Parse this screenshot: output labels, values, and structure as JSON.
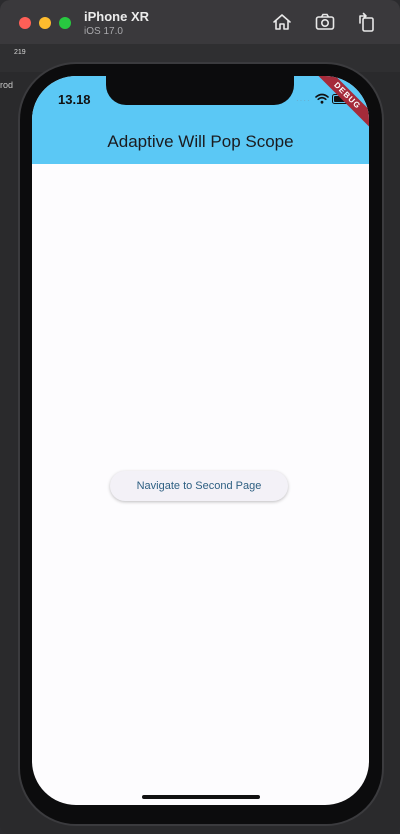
{
  "simulator": {
    "device_name": "iPhone XR",
    "os_version": "iOS 17.0",
    "toolbar_icons": [
      "home-icon",
      "screenshot-icon",
      "rotate-icon"
    ]
  },
  "desktop": {
    "badge_count": "219",
    "label": "rod"
  },
  "app": {
    "status_time": "13.18",
    "title": "Adaptive Will Pop Scope",
    "debug_banner": "DEBUG",
    "navigate_button_label": "Navigate to Second Page",
    "colors": {
      "appbar": "#5bc8f5",
      "background": "#fdfcfe",
      "button_text": "#2d5f82",
      "debug_banner": "#a52b3a"
    }
  }
}
